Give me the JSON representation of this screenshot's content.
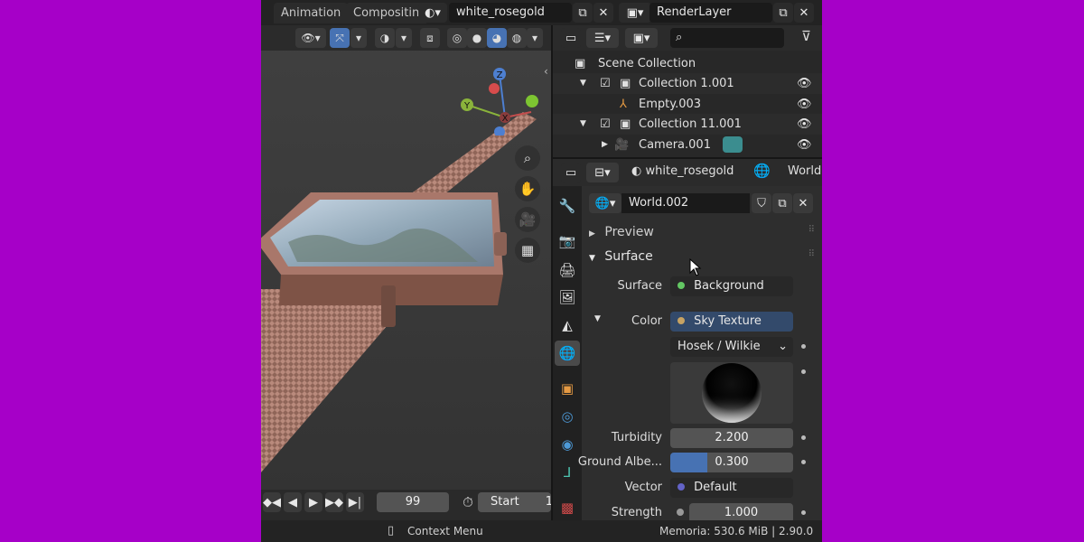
{
  "top_bar": {
    "tabs": [
      "Animation",
      "Compositin"
    ],
    "material_name": "white_rosegold",
    "render_layer": "RenderLayer"
  },
  "viewport": {
    "gizmo": {
      "z": "Z",
      "y": "Y",
      "x": "X"
    },
    "nav_icons": [
      "zoom-icon",
      "hand-pan-icon",
      "camera-icon",
      "grid-icon"
    ]
  },
  "timeline": {
    "current_frame": "99",
    "start_label": "Start",
    "start_value": "1"
  },
  "outliner": {
    "search_placeholder": "",
    "scene_collection": "Scene Collection",
    "rows": [
      {
        "label": "Collection 1.001"
      },
      {
        "label": "Empty.003"
      },
      {
        "label": "Collection 11.001"
      },
      {
        "label": "Camera.001"
      }
    ]
  },
  "properties": {
    "header_material": "white_rosegold",
    "header_world": "World.",
    "world_name": "World.002",
    "panel_preview": "Preview",
    "panel_surface": "Surface",
    "surface_label": "Surface",
    "surface_value": "Background",
    "color_label": "Color",
    "color_value": "Sky Texture",
    "sky_type": "Hosek / Wilkie",
    "turbidity_label": "Turbidity",
    "turbidity_value": "2.200",
    "ground_albedo_label": "Ground Albe...",
    "ground_albedo_value": "0.300",
    "vector_label": "Vector",
    "vector_value": "Default",
    "strength_label": "Strength",
    "strength_value": "1.000"
  },
  "status_bar": {
    "context_menu": "Context Menu",
    "memory": "Memoria: 530.6 MiB | 2.90.0"
  },
  "colors": {
    "background": "#a600c8",
    "accent_blue": "#4772b3",
    "socket_green": "#63c763",
    "socket_yellow": "#c7a363",
    "socket_purple": "#6363c7"
  }
}
